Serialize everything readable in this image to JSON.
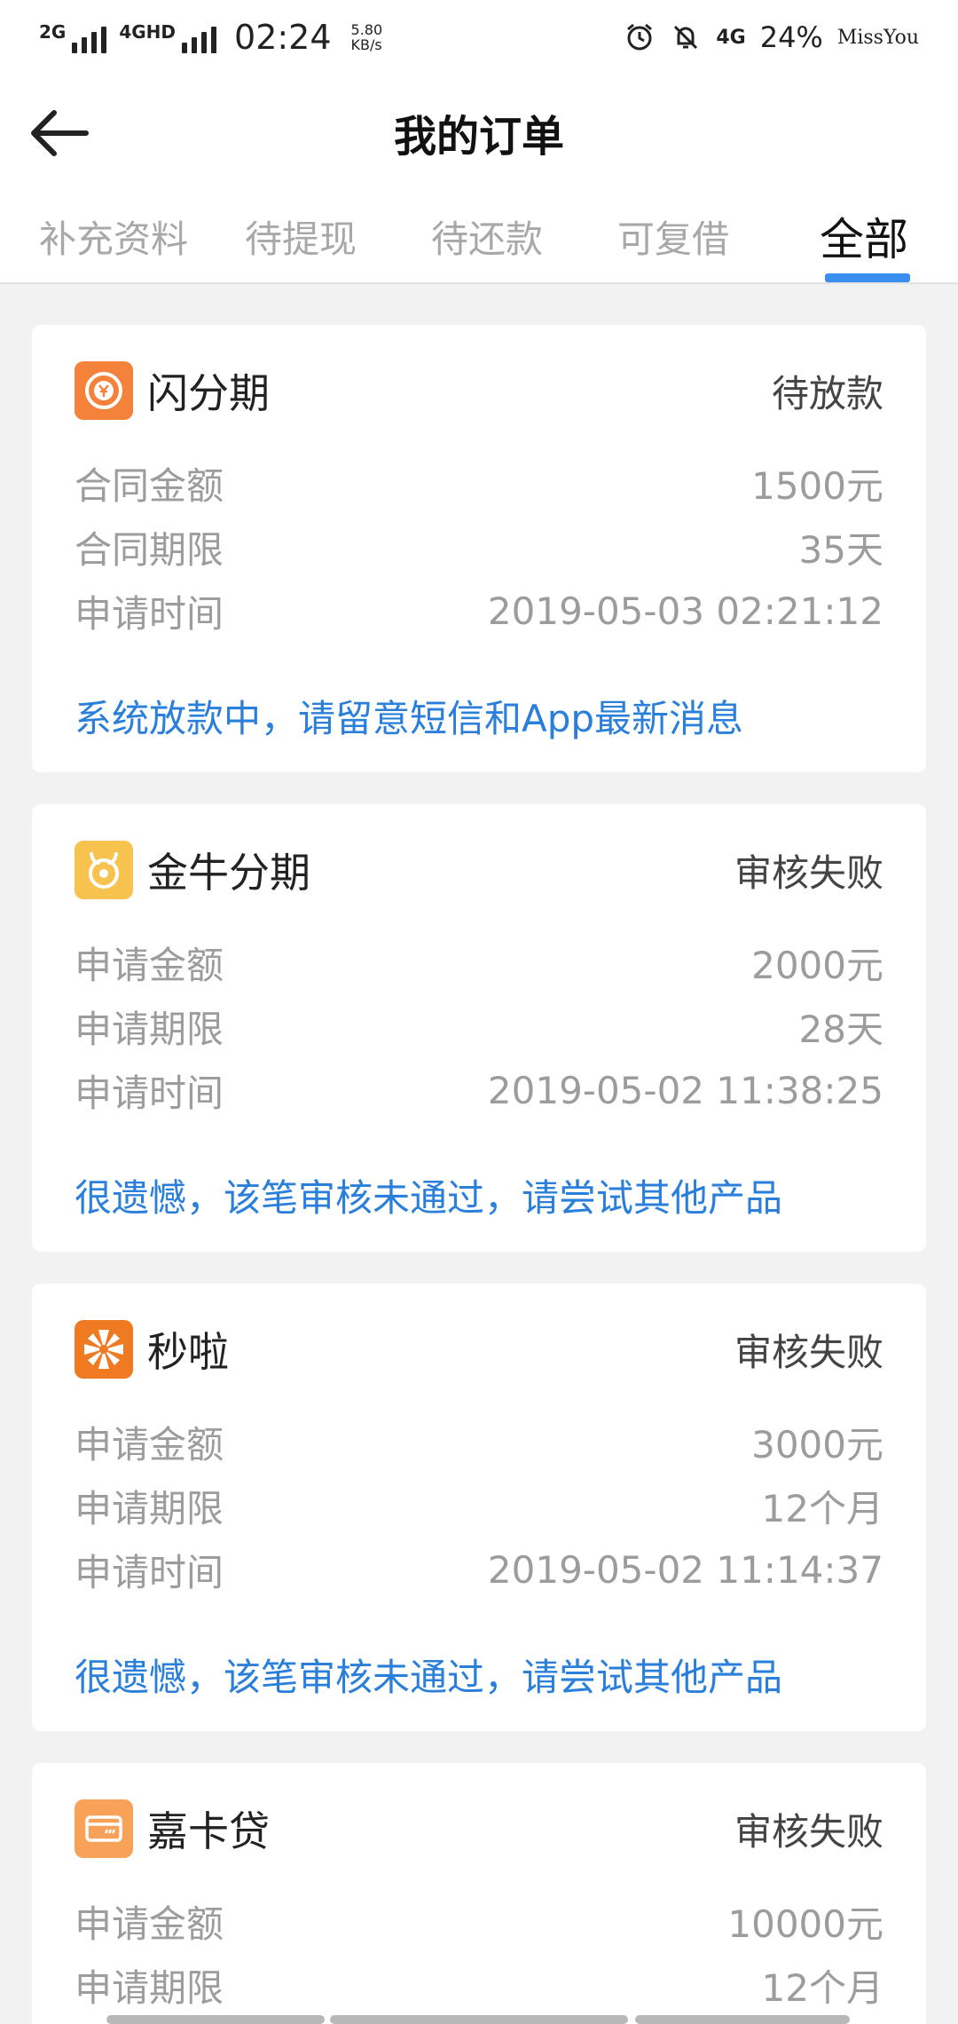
{
  "status_bar": {
    "net1": "2G",
    "net2": "4GHD",
    "time": "02:24",
    "speed_value": "5.80",
    "speed_unit": "KB/s",
    "net3": "4G",
    "battery": "24%",
    "brand": "MissYou"
  },
  "header": {
    "title": "我的订单"
  },
  "tabs": [
    {
      "label": "补充资料",
      "active": false
    },
    {
      "label": "待提现",
      "active": false
    },
    {
      "label": "待还款",
      "active": false
    },
    {
      "label": "可复借",
      "active": false
    },
    {
      "label": "全部",
      "active": true
    }
  ],
  "colors": {
    "accent": "#3b8df0",
    "link": "#2a7fdb"
  },
  "orders": [
    {
      "product": "闪分期",
      "logo_icon": "yuan-coin-icon",
      "status": "待放款",
      "fields": [
        {
          "label": "合同金额",
          "value": "1500元"
        },
        {
          "label": "合同期限",
          "value": "35天"
        },
        {
          "label": "申请时间",
          "value": "2019-05-03 02:21:12"
        }
      ],
      "message": "系统放款中，请留意短信和App最新消息"
    },
    {
      "product": "金牛分期",
      "logo_icon": "bull-icon",
      "status": "审核失败",
      "fields": [
        {
          "label": "申请金额",
          "value": "2000元"
        },
        {
          "label": "申请期限",
          "value": "28天"
        },
        {
          "label": "申请时间",
          "value": "2019-05-02 11:38:25"
        }
      ],
      "message": "很遗憾，该笔审核未通过，请尝试其他产品"
    },
    {
      "product": "秒啦",
      "logo_icon": "pinwheel-icon",
      "status": "审核失败",
      "fields": [
        {
          "label": "申请金额",
          "value": "3000元"
        },
        {
          "label": "申请期限",
          "value": "12个月"
        },
        {
          "label": "申请时间",
          "value": "2019-05-02 11:14:37"
        }
      ],
      "message": "很遗憾，该笔审核未通过，请尝试其他产品"
    },
    {
      "product": "嘉卡贷",
      "logo_icon": "card-icon",
      "status": "审核失败",
      "fields": [
        {
          "label": "申请金额",
          "value": "10000元"
        },
        {
          "label": "申请期限",
          "value": "12个月"
        }
      ]
    }
  ]
}
